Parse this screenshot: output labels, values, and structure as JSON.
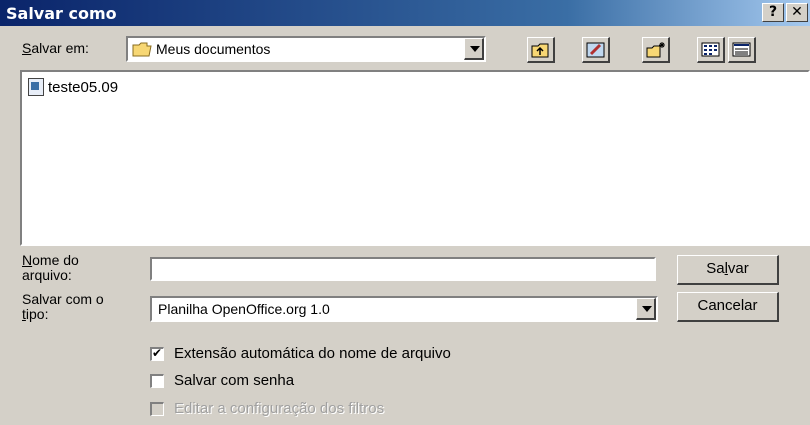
{
  "window": {
    "title": "Salvar como",
    "help_label": "?",
    "close_label": "✕"
  },
  "location": {
    "label_hotkey": "S",
    "label_rest": "alvar em:",
    "value": "Meus documentos"
  },
  "toolbar": {
    "icons": [
      "up-one-level-icon",
      "desktop-icon",
      "new-folder-icon",
      "list-view-icon",
      "details-view-icon"
    ]
  },
  "files": [
    {
      "name": "teste05.09",
      "icon": "document-icon"
    }
  ],
  "filename": {
    "label_line1_hotkey": "N",
    "label_line1_rest": "ome do",
    "label_line2": "arquivo:",
    "value": ""
  },
  "filetype": {
    "label_line1": "Salvar com o",
    "label_line2_hotkey": "t",
    "label_line2_rest": "ipo:",
    "value": "Planilha OpenOffice.org 1.0"
  },
  "buttons": {
    "save_pre": "Sa",
    "save_hotkey": "l",
    "save_post": "var",
    "cancel": "Cancelar"
  },
  "options": [
    {
      "label": "Extensão automática do nome de arquivo",
      "checked": true,
      "enabled": true
    },
    {
      "label": "Salvar com senha",
      "checked": false,
      "enabled": true
    },
    {
      "label": "Editar a configuração dos filtros",
      "checked": false,
      "enabled": false
    }
  ],
  "colors": {
    "titlebar_start": "#0a246a",
    "face": "#d4d0c8"
  }
}
